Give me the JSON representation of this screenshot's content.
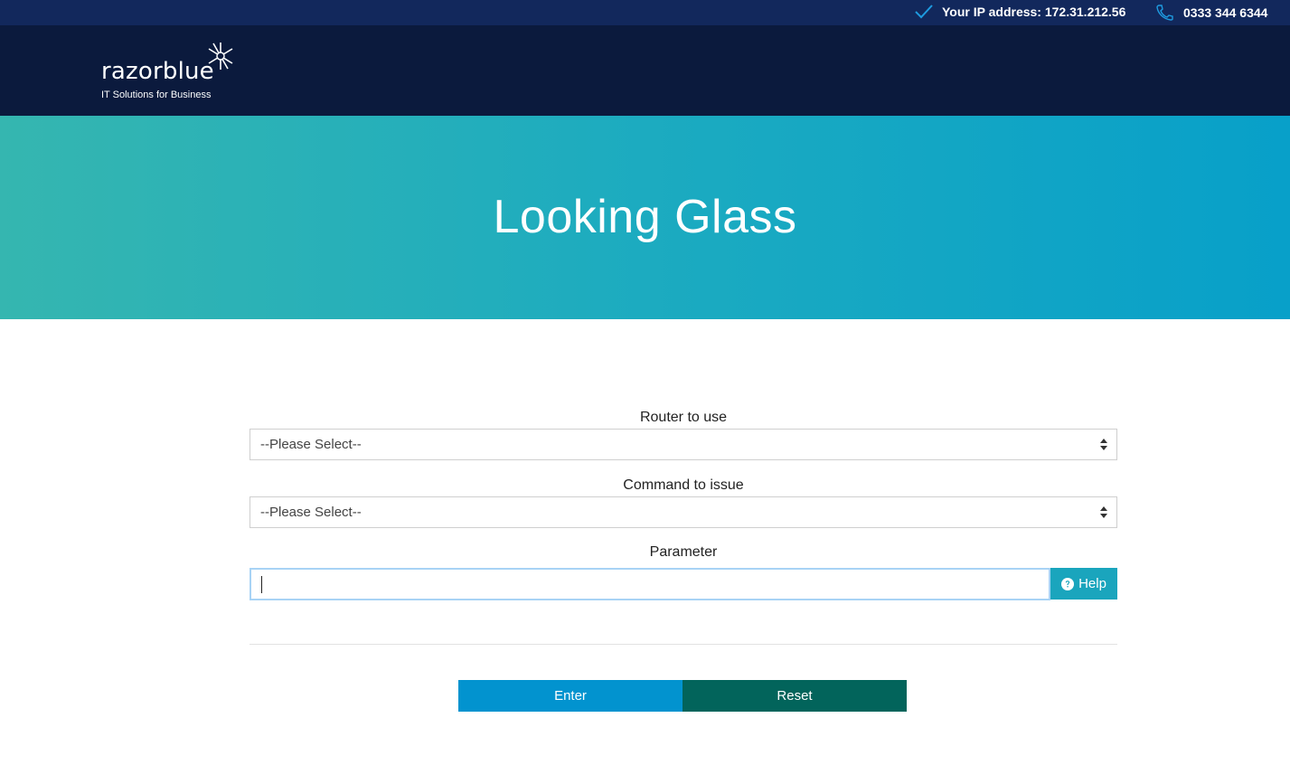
{
  "topbar": {
    "ip_label": "Your IP address: 172.31.212.56",
    "phone": "0333 344 6344",
    "icons": [
      "checkmark-icon",
      "phone-icon"
    ]
  },
  "brand": {
    "name": "razorblue",
    "tagline": "IT Solutions for Business"
  },
  "hero": {
    "title": "Looking Glass"
  },
  "form": {
    "router_label": "Router to use",
    "router_value": "--Please Select--",
    "command_label": "Command to issue",
    "command_value": "--Please Select--",
    "parameter_label": "Parameter",
    "parameter_value": "",
    "help_label": "Help"
  },
  "actions": {
    "enter_label": "Enter",
    "reset_label": "Reset"
  },
  "colors": {
    "topbar": "#12285c",
    "header": "#0b1a3d",
    "hero_start": "#35b6b0",
    "hero_end": "#08a0c9",
    "help": "#1aa5bd",
    "enter": "#0293cf",
    "reset": "#02645b"
  }
}
